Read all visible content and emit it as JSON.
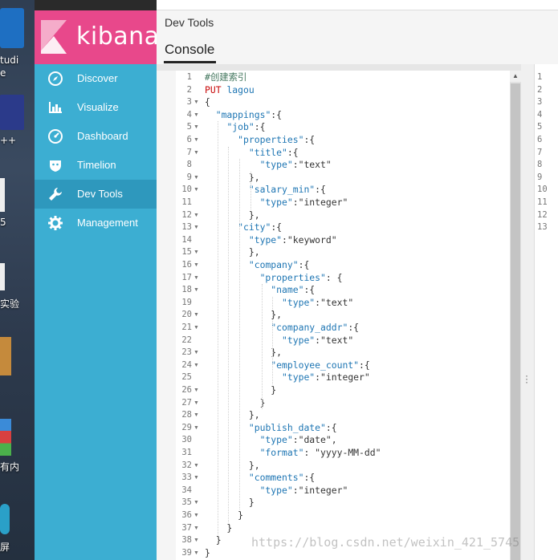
{
  "desktop": {
    "labels": [
      "tudi",
      "e",
      "++",
      "5",
      "实验",
      "有内",
      "屏"
    ]
  },
  "nav": {
    "logo": "kibana",
    "items": [
      {
        "label": "Discover",
        "icon": "compass-icon"
      },
      {
        "label": "Visualize",
        "icon": "bar-chart-icon"
      },
      {
        "label": "Dashboard",
        "icon": "dashboard-gauge-icon"
      },
      {
        "label": "Timelion",
        "icon": "timelion-shield-icon"
      },
      {
        "label": "Dev Tools",
        "icon": "wrench-icon",
        "active": true
      },
      {
        "label": "Management",
        "icon": "gear-icon"
      }
    ],
    "colors": {
      "logo_bg": "#e8488b",
      "nav_bg": "#3caed2",
      "active_bg": "#2e98bd"
    }
  },
  "main": {
    "app_title": "Dev Tools",
    "tab": "Console"
  },
  "editor": {
    "lines": [
      "#创建索引",
      "PUT lagou",
      "{",
      "  \"mappings\":{",
      "    \"job\":{",
      "      \"properties\":{",
      "        \"title\":{",
      "          \"type\":\"text\"",
      "        },",
      "        \"salary_min\":{",
      "          \"type\":\"integer\"",
      "        },",
      "      \"city\":{",
      "        \"type\":\"keyword\"",
      "        },",
      "        \"company\":{",
      "          \"properties\": {",
      "            \"name\":{",
      "              \"type\":\"text\"",
      "            },",
      "            \"company_addr\":{",
      "              \"type\":\"text\"",
      "            },",
      "            \"employee_count\":{",
      "              \"type\":\"integer\"",
      "            }",
      "          }",
      "        },",
      "        \"publish_date\":{",
      "          \"type\":\"date\",",
      "          \"format\": \"yyyy-MM-dd\"",
      "        },",
      "        \"comments\":{",
      "          \"type\":\"integer\"",
      "        }",
      "      }",
      "    }",
      "  }",
      "}"
    ],
    "line_numbers": [
      "1",
      "2",
      "3",
      "4",
      "5",
      "6",
      "7",
      "8",
      "9",
      "10",
      "11",
      "12",
      "13",
      "14",
      "15",
      "16",
      "17",
      "18",
      "19",
      "20",
      "21",
      "22",
      "23",
      "24",
      "25",
      "26",
      "27",
      "28",
      "29",
      "30",
      "31",
      "32",
      "33",
      "34",
      "35",
      "36",
      "37",
      "38",
      "39"
    ],
    "fold_lines": [
      3,
      4,
      5,
      6,
      7,
      9,
      10,
      12,
      13,
      15,
      16,
      17,
      18,
      20,
      21,
      23,
      24,
      26,
      27,
      28,
      29,
      32,
      33,
      35,
      36,
      37,
      38,
      39
    ]
  },
  "output": {
    "line_numbers": [
      "1",
      "2",
      "3",
      "4",
      "5",
      "6",
      "7",
      "8",
      "9",
      "10",
      "11",
      "12",
      "13"
    ]
  },
  "watermark": "https://blog.csdn.net/weixin_421_5745"
}
